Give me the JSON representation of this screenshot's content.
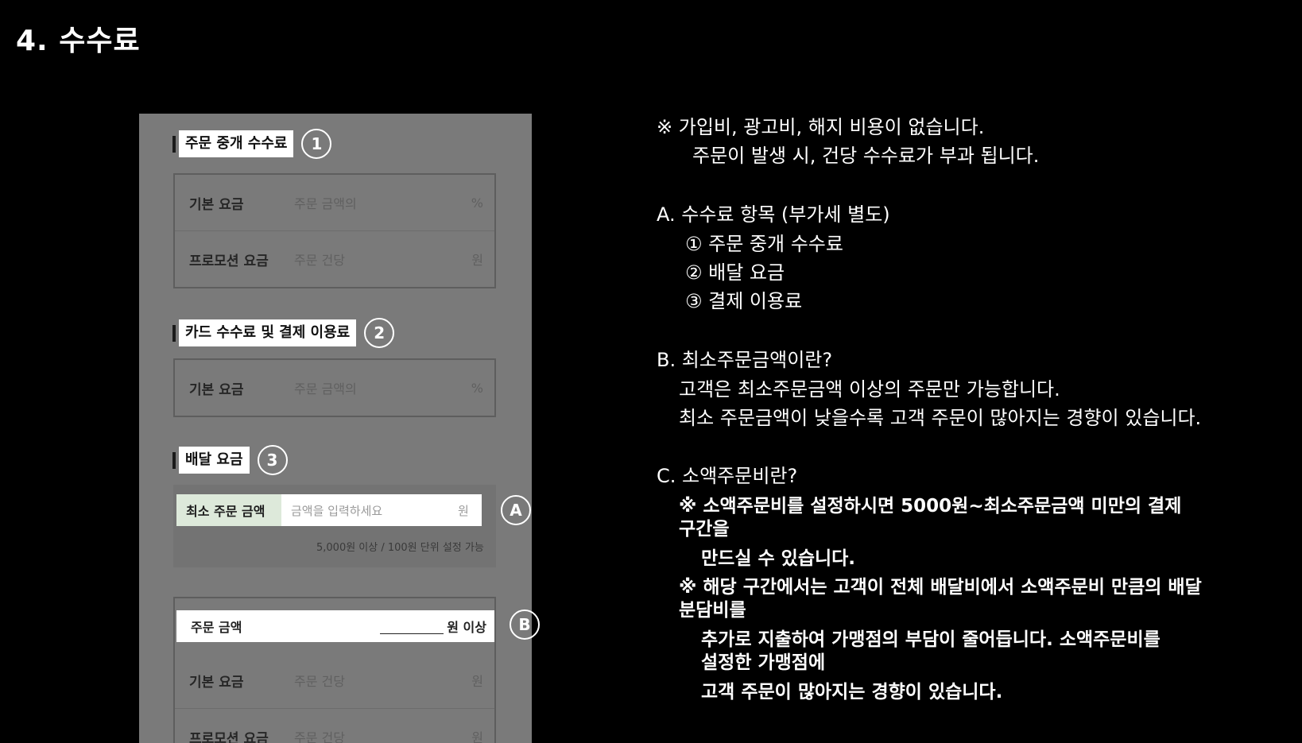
{
  "page_title": "4. 수수료",
  "panel": {
    "section1": {
      "title": "주문 중개 수수료",
      "badge": "1",
      "rows": [
        {
          "label": "기본 요금",
          "value": "주문 금액의",
          "unit": "%"
        },
        {
          "label": "프로모션 요금",
          "value": "주문 건당",
          "unit": "원"
        }
      ]
    },
    "section2": {
      "title": "카드 수수료 및 결제 이용료",
      "badge": "2",
      "rows": [
        {
          "label": "기본 요금",
          "value": "주문 금액의",
          "unit": "%"
        }
      ]
    },
    "section3": {
      "title": "배달 요금",
      "badge": "3",
      "min_order": {
        "label": "최소 주문 금액",
        "placeholder": "금액을 입력하세요",
        "unit": "원",
        "badge": "A"
      },
      "hint": "5,000원 이상 / 100원 단위 설정 가능",
      "order_amount": {
        "label": "주문 금액",
        "unit": "원 이상",
        "badge": "B"
      },
      "rows": [
        {
          "label": "기본 요금",
          "value": "주문 건당",
          "unit": "원"
        },
        {
          "label": "프로모션 요금",
          "value": "주문 건당",
          "unit": "원"
        }
      ]
    }
  },
  "right": {
    "note1": "※ 가입비, 광고비, 해지 비용이 없습니다.",
    "note2": "주문이 발생 시, 건당 수수료가 부과 됩니다.",
    "a_title": "A. 수수료 항목 (부가세 별도)",
    "a_items": [
      "① 주문 중개 수수료",
      "② 배달 요금",
      "③ 결제 이용료"
    ],
    "b_title": "B. 최소주문금액이란?",
    "b_lines": [
      "고객은 최소주문금액 이상의 주문만 가능합니다.",
      "최소 주문금액이 낮을수록 고객 주문이 많아지는 경향이 있습니다."
    ],
    "c_title": "C. 소액주문비란?",
    "c_lines": [
      "※ 소액주문비를 설정하시면 5000원~최소주문금액 미만의 결제",
      "구간을",
      "만드실 수 있습니다.",
      "※ 해당 구간에서는 고객이 전체 배달비에서 소액주문비 만큼의 배달",
      "분담비를",
      "추가로 지출하여 가맹점의 부담이 줄어듭니다. 소액주문비를",
      "설정한 가맹점에",
      "고객 주문이 많아지는 경향이 있습니다."
    ]
  }
}
